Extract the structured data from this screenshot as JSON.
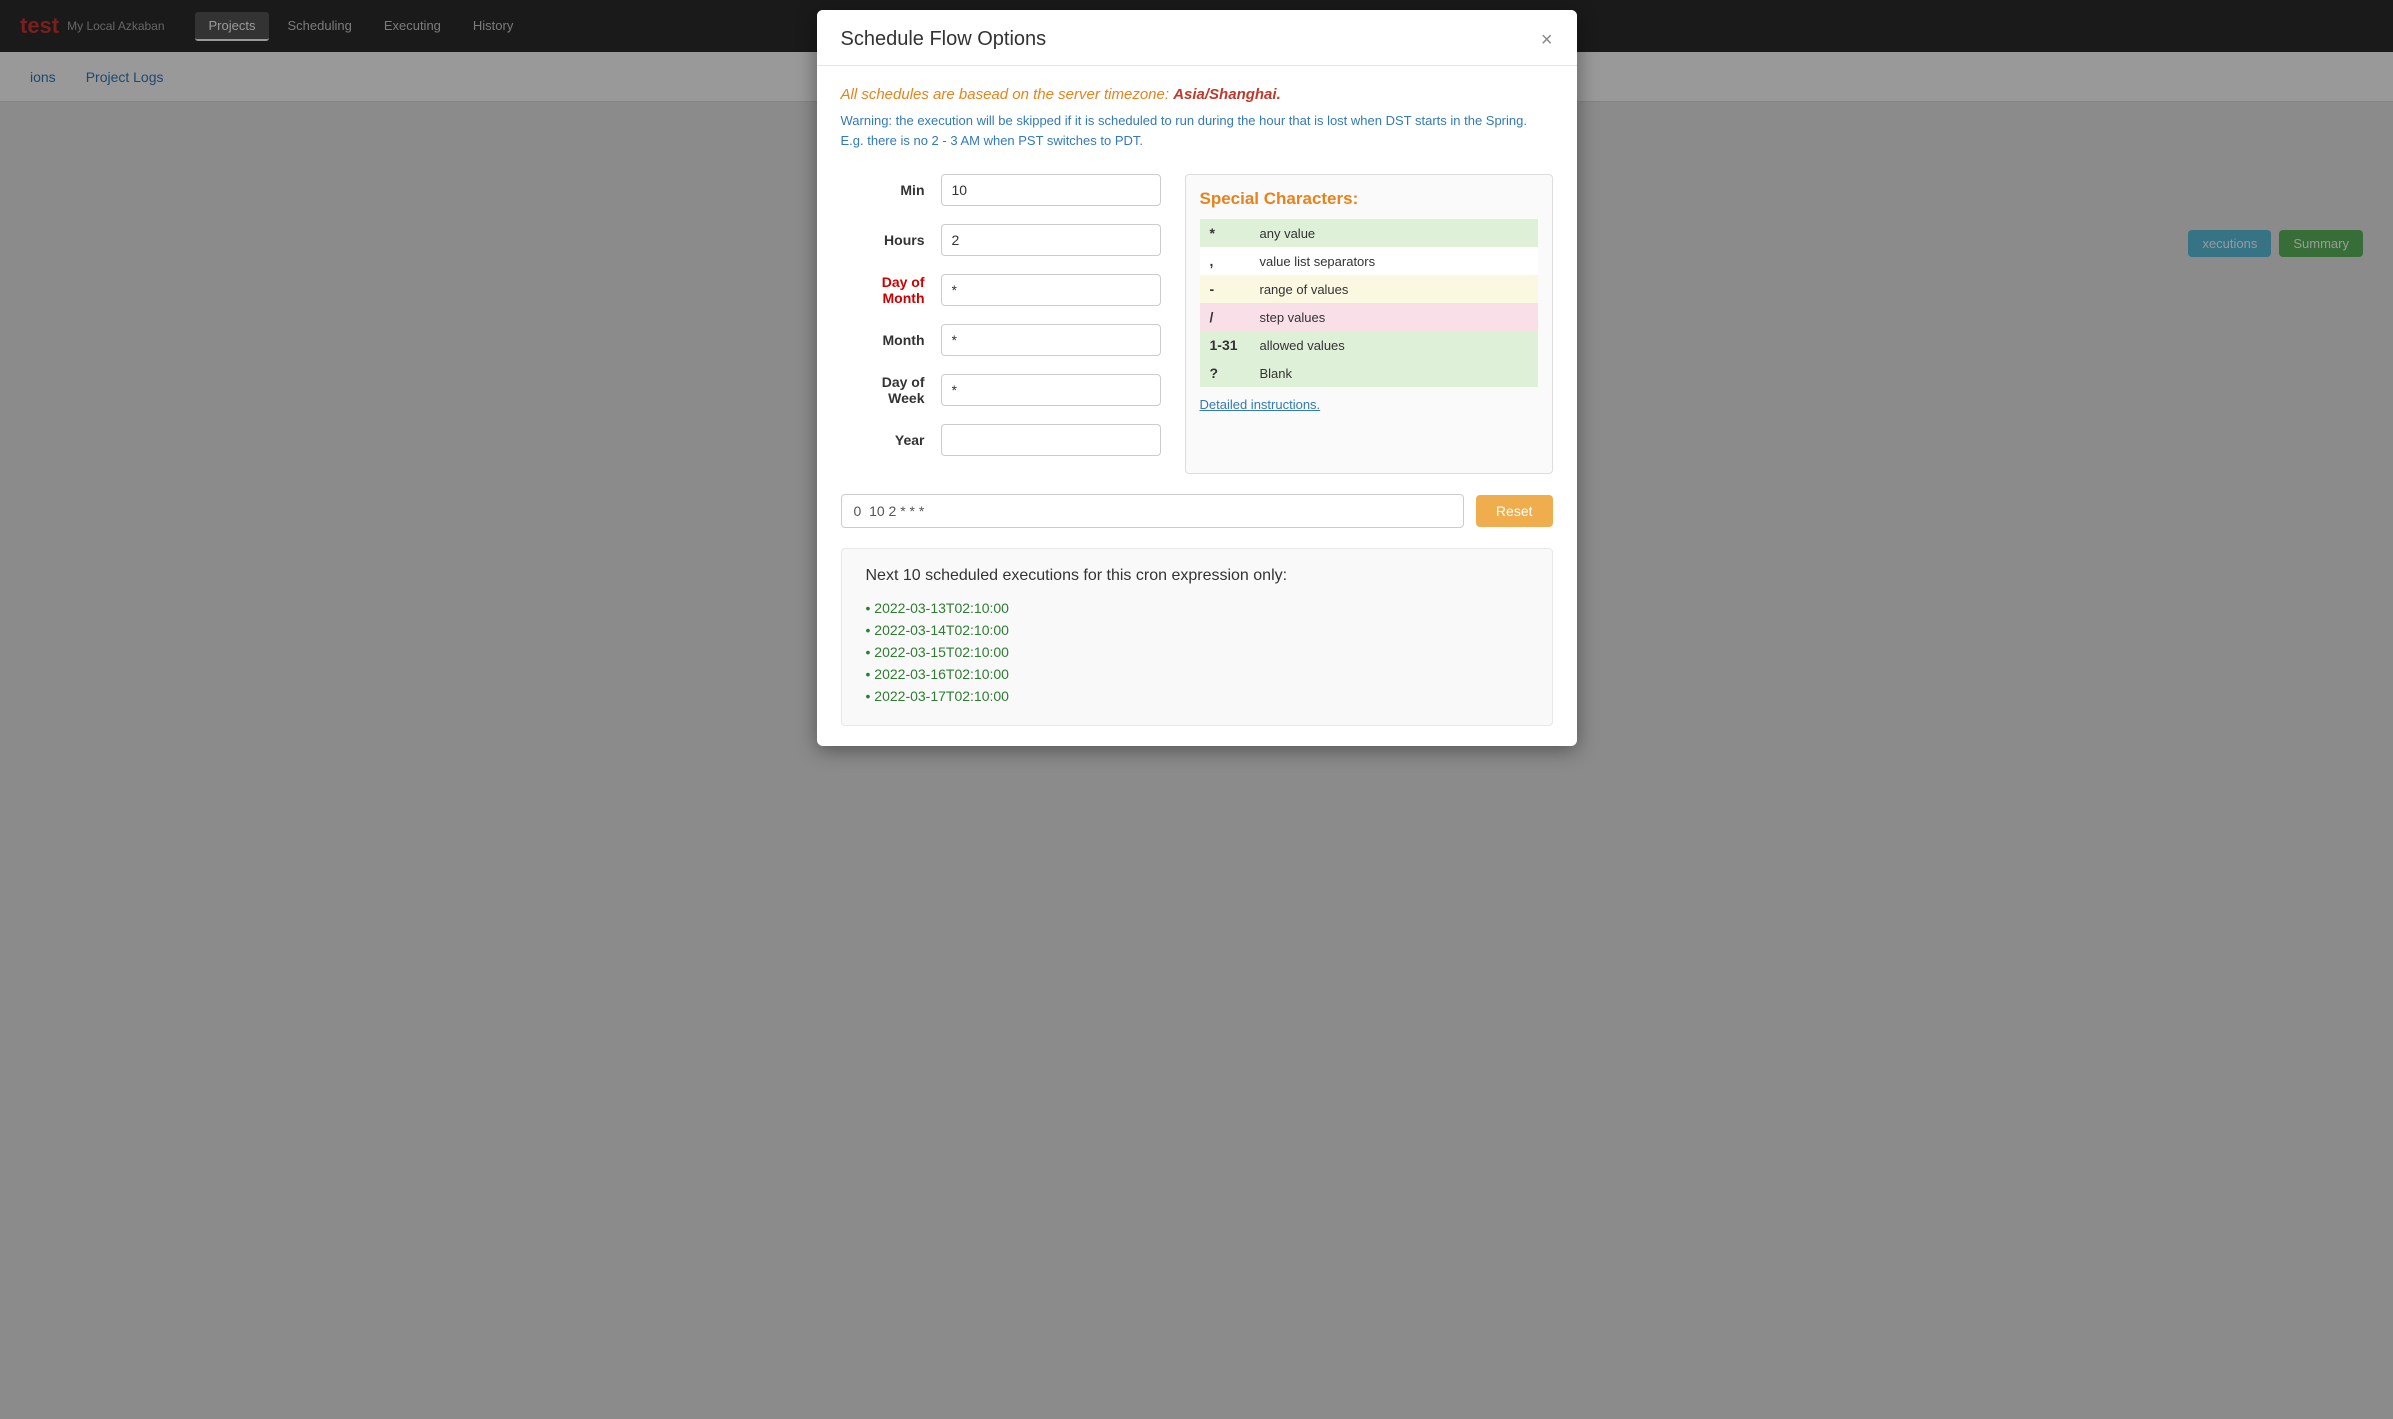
{
  "navbar": {
    "brand": "test",
    "subtitle": "My Local Azkaban",
    "links": [
      "Projects",
      "Scheduling",
      "Executing",
      "History"
    ],
    "active_link": "Projects"
  },
  "subnav": {
    "links": [
      "ions",
      "Project Logs"
    ]
  },
  "right_buttons": {
    "executions_label": "xecutions",
    "summary_label": "Summary"
  },
  "modal": {
    "title": "Schedule Flow Options",
    "close_icon": "×",
    "timezone_notice": "All schedules are basead on the server timezone:",
    "timezone_value": "Asia/Shanghai.",
    "dst_warning": "Warning: the execution will be skipped if it is scheduled to run during the hour that is lost when DST starts in the Spring. E.g. there is no 2 - 3 AM when PST switches to PDT.",
    "fields": {
      "min_label": "Min",
      "min_value": "10",
      "hours_label": "Hours",
      "hours_value": "2",
      "day_of_month_label": "Day of Month",
      "day_of_month_value": "*",
      "month_label": "Month",
      "month_value": "*",
      "day_of_week_label": "Day of Week",
      "day_of_week_value": "*",
      "year_label": "Year",
      "year_value": ""
    },
    "special_chars": {
      "title": "Special Characters:",
      "entries": [
        {
          "symbol": "*",
          "description": "any value"
        },
        {
          "symbol": ",",
          "description": "value list separators"
        },
        {
          "symbol": "-",
          "description": "range of values"
        },
        {
          "symbol": "/",
          "description": "step values"
        },
        {
          "symbol": "1-31",
          "description": "allowed values"
        },
        {
          "symbol": "?",
          "description": "Blank"
        }
      ],
      "detailed_link": "Detailed instructions."
    },
    "cron_expression": "0  10 2 * * *",
    "reset_label": "Reset",
    "next_executions_title": "Next 10 scheduled executions for this cron expression only:",
    "executions": [
      "2022-03-13T02:10:00",
      "2022-03-14T02:10:00",
      "2022-03-15T02:10:00",
      "2022-03-16T02:10:00",
      "2022-03-17T02:10:00"
    ]
  }
}
